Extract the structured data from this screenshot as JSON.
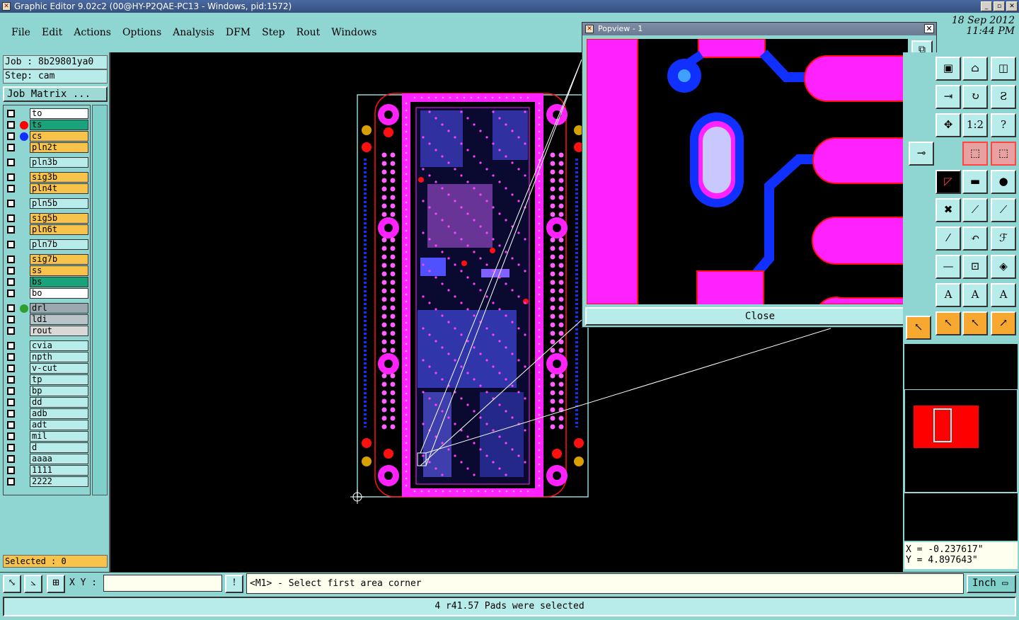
{
  "window": {
    "title": "Graphic Editor 9.02c2 (00@HY-P2QAE-PC13 - Windows, pid:1572)",
    "date": "18 Sep 2012",
    "time": "11:44 PM"
  },
  "menu": [
    "File",
    "Edit",
    "Actions",
    "Options",
    "Analysis",
    "DFM",
    "Step",
    "Rout",
    "Windows"
  ],
  "job": {
    "job_line": "Job : 8b29801ya0",
    "step_line": "Step: cam",
    "matrix_button": "Job Matrix ..."
  },
  "layers": [
    {
      "name": "to",
      "bg": "#ffffff",
      "dot": "",
      "mark": "◢"
    },
    {
      "name": "ts",
      "bg": "#1aa37a",
      "dot": "#ff0000",
      "mark": "▦"
    },
    {
      "name": "cs",
      "bg": "#f7c34a",
      "dot": "#1030ff",
      "mark": ""
    },
    {
      "name": "pln2t",
      "bg": "#f7c34a",
      "dot": "",
      "mark": ""
    },
    {
      "name": "pln3b",
      "bg": "#b8ecea",
      "dot": "",
      "mark": ""
    },
    {
      "name": "sig3b",
      "bg": "#f7c34a",
      "dot": "",
      "mark": ""
    },
    {
      "name": "pln4t",
      "bg": "#f7c34a",
      "dot": "",
      "mark": ""
    },
    {
      "name": "pln5b",
      "bg": "#b8ecea",
      "dot": "",
      "mark": ""
    },
    {
      "name": "sig5b",
      "bg": "#f7c34a",
      "dot": "",
      "mark": ""
    },
    {
      "name": "pln6t",
      "bg": "#f7c34a",
      "dot": "",
      "mark": ""
    },
    {
      "name": "pln7b",
      "bg": "#b8ecea",
      "dot": "",
      "mark": ""
    },
    {
      "name": "sig7b",
      "bg": "#f7c34a",
      "dot": "",
      "mark": ""
    },
    {
      "name": "ss",
      "bg": "#f7c34a",
      "dot": "",
      "mark": ""
    },
    {
      "name": "bs",
      "bg": "#1aa37a",
      "dot": "",
      "mark": ""
    },
    {
      "name": "bo",
      "bg": "#ffffff",
      "dot": "",
      "mark": "◢"
    },
    {
      "name": "drl",
      "bg": "#9aa8b0",
      "dot": "#2ea02e",
      "mark": ""
    },
    {
      "name": "ldi",
      "bg": "#b8c4c8",
      "dot": "",
      "mark": ""
    },
    {
      "name": "rout",
      "bg": "#d8d8d8",
      "dot": "",
      "mark": ""
    },
    {
      "name": "cvia",
      "bg": "#b8ecea",
      "dot": "",
      "mark": ""
    },
    {
      "name": "npth",
      "bg": "#b8ecea",
      "dot": "",
      "mark": ""
    },
    {
      "name": "v-cut",
      "bg": "#b8ecea",
      "dot": "",
      "mark": ""
    },
    {
      "name": "tp",
      "bg": "#b8ecea",
      "dot": "",
      "mark": ""
    },
    {
      "name": "bp",
      "bg": "#b8ecea",
      "dot": "",
      "mark": ""
    },
    {
      "name": "dd",
      "bg": "#b8ecea",
      "dot": "",
      "mark": ""
    },
    {
      "name": "adb",
      "bg": "#b8ecea",
      "dot": "",
      "mark": "◢"
    },
    {
      "name": "adt",
      "bg": "#b8ecea",
      "dot": "",
      "mark": "◢"
    },
    {
      "name": "mil",
      "bg": "#b8ecea",
      "dot": "",
      "mark": ""
    },
    {
      "name": "d",
      "bg": "#b8ecea",
      "dot": "",
      "mark": ""
    },
    {
      "name": "aaaa",
      "bg": "#b8ecea",
      "dot": "",
      "mark": ""
    },
    {
      "name": "1111",
      "bg": "#b8ecea",
      "dot": "",
      "mark": ""
    },
    {
      "name": "2222",
      "bg": "#b8ecea",
      "dot": "",
      "mark": ""
    }
  ],
  "selected_text": "Selected : 0",
  "popview": {
    "title": "Popview - 1",
    "close_label": "Close"
  },
  "toolbar": {
    "ratio_label": "1:2"
  },
  "coords": {
    "x": "X = -0.237617\"",
    "y": "Y = 4.897643\""
  },
  "bottom": {
    "xy_label": "X Y :",
    "xy_value": "",
    "prompt": "<M1> - Select first area corner",
    "unit": "Inch"
  },
  "status": "4 r41.57 Pads were selected",
  "colors": {
    "magenta": "#ff22ff",
    "blue": "#1030ff",
    "red": "#ff0000",
    "panel": "#8fd6d3"
  }
}
